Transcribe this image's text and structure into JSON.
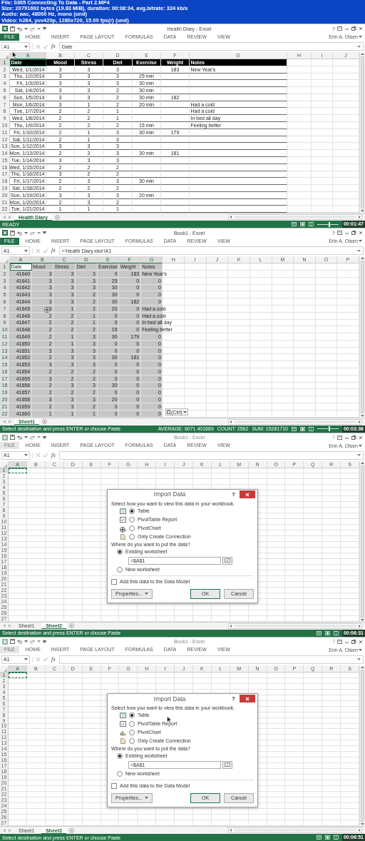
{
  "header": {
    "lines": [
      "File: 0305 Connecting To Data - Part 2.MP4",
      "Size: 20791692 bytes (19.83 MiB), duration: 00:08:34, avg.bitrate: 324 kb/s",
      "Audio: aac, 48000 Hz, mono (und)",
      "Video: h264, yuv420p, 1280x720, 15.00 fps(r) (und)"
    ]
  },
  "frames": [
    {
      "window_title": "Health Diary - Excel",
      "window_active": true,
      "help_button": "?",
      "ribbon_tabs": [
        {
          "label": "FILE",
          "kind": "file"
        },
        {
          "label": "HOME",
          "kind": "tab"
        },
        {
          "label": "INSERT",
          "kind": "tab"
        },
        {
          "label": "PAGE LAYOUT",
          "kind": "tab"
        },
        {
          "label": "FORMULAS",
          "kind": "tab"
        },
        {
          "label": "DATA",
          "kind": "tab"
        },
        {
          "label": "REVIEW",
          "kind": "tab"
        },
        {
          "label": "VIEW",
          "kind": "tab"
        }
      ],
      "user": "Erin A. Olsen",
      "name_box": "A1",
      "function_label": "fx",
      "formula": "Date",
      "columns": [
        "A",
        "B",
        "C",
        "D",
        "E",
        "F",
        "G",
        "H",
        "I",
        "J"
      ],
      "selection": {
        "kind": "cell"
      },
      "cursor": {
        "kind": "arrow"
      },
      "table": {
        "kind": "banded",
        "rows": [
          {
            "number": "1",
            "cells": [
              "Date",
              "Mood",
              "Stress",
              "Diet",
              "Exercise",
              "Weight",
              "Notes"
            ]
          },
          {
            "number": "2",
            "cells": [
              "Wed, 1/1/2014",
              "3",
              "3",
              "3",
              null,
              "183",
              "New Year's"
            ]
          },
          {
            "number": "3",
            "cells": [
              "Thu, 1/2/2014",
              "3",
              "3",
              "3",
              "25 min"
            ]
          },
          {
            "number": "4",
            "cells": [
              "Fri, 1/3/2014",
              "3",
              "3",
              "3",
              "30 min"
            ]
          },
          {
            "number": "5",
            "cells": [
              "Sat, 1/4/2014",
              "3",
              "3",
              "2",
              "30 min"
            ]
          },
          {
            "number": "6",
            "cells": [
              "Sun, 1/5/2014",
              "3",
              "3",
              "2",
              "30 min",
              "182"
            ]
          },
          {
            "number": "7",
            "cells": [
              "Mon, 1/6/2014",
              "3",
              "1",
              "2",
              "20 min",
              null,
              "Had a cold"
            ]
          },
          {
            "number": "8",
            "cells": [
              "Tue, 1/7/2014",
              "2",
              "2",
              "1",
              null,
              null,
              "Had a cold"
            ]
          },
          {
            "number": "9",
            "cells": [
              "Wed, 1/8/2014",
              "2",
              "2",
              "1",
              null,
              null,
              "In bed all day"
            ]
          },
          {
            "number": "10",
            "cells": [
              "Thu, 1/9/2014",
              "2",
              "2",
              "2",
              "15 min",
              null,
              "Feeling better"
            ]
          },
          {
            "number": "11",
            "cells": [
              "Fri, 1/10/2014",
              "2",
              "1",
              "3",
              "30 min",
              "179"
            ]
          },
          {
            "number": "12",
            "cells": [
              "Sat, 1/11/2014",
              "2",
              "1",
              "3"
            ]
          },
          {
            "number": "13",
            "cells": [
              "Sun, 1/12/2014",
              "3",
              "3",
              "3"
            ]
          },
          {
            "number": "14",
            "cells": [
              "Mon, 1/13/2014",
              "2",
              "3",
              "3",
              "30 min",
              "181"
            ]
          },
          {
            "number": "15",
            "cells": [
              "Tue, 1/14/2014",
              "3",
              "3",
              "3"
            ]
          },
          {
            "number": "16",
            "cells": [
              "Wed, 1/15/2014",
              "2",
              "2",
              "2"
            ]
          },
          {
            "number": "17",
            "cells": [
              "Thu, 1/16/2014",
              "3",
              "2",
              "2"
            ]
          },
          {
            "number": "18",
            "cells": [
              "Fri, 1/17/2014",
              "2",
              "3",
              "3",
              "30 min"
            ]
          },
          {
            "number": "19",
            "cells": [
              "Sat, 1/18/2014",
              "2",
              "2",
              "2"
            ]
          },
          {
            "number": "20",
            "cells": [
              "Sun, 1/19/2014",
              "3",
              "3",
              "3",
              "20 min"
            ]
          },
          {
            "number": "21",
            "cells": [
              "Mon, 1/20/2014",
              "2",
              "3",
              "2"
            ]
          },
          {
            "number": "22",
            "cells": [
              "Tue, 1/21/2014",
              "1",
              "1",
              "1"
            ]
          }
        ]
      },
      "sheet_tabs": [
        {
          "label": "Health Diary",
          "selected": true
        }
      ],
      "status": {
        "message": "READY"
      },
      "zoom_slider": {
        "level": 0.55
      },
      "timestamp": "00:01:47"
    },
    {
      "window_title": "Book1 - Excel",
      "window_active": true,
      "help_button": "?",
      "ribbon_tabs": [
        {
          "label": "FILE",
          "kind": "file"
        },
        {
          "label": "HOME",
          "kind": "tab"
        },
        {
          "label": "INSERT",
          "kind": "tab"
        },
        {
          "label": "PAGE LAYOUT",
          "kind": "tab"
        },
        {
          "label": "FORMULAS",
          "kind": "tab"
        },
        {
          "label": "DATA",
          "kind": "tab"
        },
        {
          "label": "REVIEW",
          "kind": "tab"
        },
        {
          "label": "VIEW",
          "kind": "tab"
        }
      ],
      "user": "Erin A. Olsen",
      "name_box": "A1",
      "function_label": "fx",
      "formula": "='Health Diary.xlsx'!A1",
      "columns": [
        "A",
        "B",
        "C",
        "D",
        "E",
        "F",
        "G",
        "H",
        "I",
        "J",
        "K",
        "L",
        "M",
        "N",
        "O",
        "P"
      ],
      "selection": {
        "kind": "range"
      },
      "cursor": {
        "kind": "move"
      },
      "table": {
        "kind": "plain",
        "rows": [
          {
            "number": "1",
            "cells": [
              "Date",
              "Mood",
              "Stress",
              "Diet",
              "Exercise",
              "Weight",
              "Notes"
            ]
          },
          {
            "number": "2",
            "cells": [
              "41640",
              "3",
              "3",
              "3",
              "0",
              "183",
              "New Year's"
            ]
          },
          {
            "number": "3",
            "cells": [
              "41641",
              "3",
              "3",
              "3",
              "25",
              "0",
              "0"
            ]
          },
          {
            "number": "4",
            "cells": [
              "41642",
              "3",
              "3",
              "3",
              "30",
              "0",
              "0"
            ]
          },
          {
            "number": "5",
            "cells": [
              "41643",
              "3",
              "3",
              "2",
              "30",
              "0",
              "0"
            ]
          },
          {
            "number": "6",
            "cells": [
              "41644",
              "3",
              "3",
              "2",
              "30",
              "182",
              "0"
            ]
          },
          {
            "number": "7",
            "cells": [
              "41645",
              "3",
              "1",
              "2",
              "20",
              "0",
              "Had a cold"
            ]
          },
          {
            "number": "8",
            "cells": [
              "41646",
              "2",
              "2",
              "1",
              "0",
              "0",
              "Had a cold"
            ]
          },
          {
            "number": "9",
            "cells": [
              "41647",
              "2",
              "2",
              "1",
              "0",
              "0",
              "In bed all day"
            ]
          },
          {
            "number": "10",
            "cells": [
              "41648",
              "2",
              "2",
              "2",
              "15",
              "0",
              "Feeling better"
            ]
          },
          {
            "number": "11",
            "cells": [
              "41649",
              "2",
              "1",
              "3",
              "30",
              "179",
              "0"
            ]
          },
          {
            "number": "12",
            "cells": [
              "41650",
              "2",
              "1",
              "3",
              "0",
              "0",
              "0"
            ]
          },
          {
            "number": "13",
            "cells": [
              "41651",
              "3",
              "3",
              "3",
              "0",
              "0",
              "0"
            ]
          },
          {
            "number": "14",
            "cells": [
              "41652",
              "2",
              "3",
              "3",
              "30",
              "181",
              "0"
            ]
          },
          {
            "number": "15",
            "cells": [
              "41653",
              "3",
              "3",
              "3",
              "0",
              "0",
              "0"
            ]
          },
          {
            "number": "16",
            "cells": [
              "41654",
              "2",
              "2",
              "2",
              "0",
              "0",
              "0"
            ]
          },
          {
            "number": "17",
            "cells": [
              "41655",
              "3",
              "2",
              "2",
              "0",
              "0",
              "0"
            ]
          },
          {
            "number": "18",
            "cells": [
              "41656",
              "2",
              "3",
              "3",
              "30",
              "0",
              "0"
            ]
          },
          {
            "number": "19",
            "cells": [
              "41657",
              "2",
              "2",
              "2",
              "0",
              "0",
              "0"
            ]
          },
          {
            "number": "20",
            "cells": [
              "41658",
              "3",
              "3",
              "3",
              "20",
              "0",
              "0"
            ]
          },
          {
            "number": "21",
            "cells": [
              "41659",
              "2",
              "3",
              "2",
              "0",
              "0",
              "0"
            ]
          },
          {
            "number": "22",
            "cells": [
              "41660",
              "1",
              "1",
              "1",
              "0",
              "0",
              "0"
            ]
          }
        ]
      },
      "paste_options": {
        "label": "(Ctrl)"
      },
      "sheet_tabs": [
        {
          "label": "Sheet1",
          "selected": true
        }
      ],
      "status": {
        "message": "Select destination and press ENTER or choose Paste",
        "stats": [
          "AVERAGE: 6071.401669",
          "COUNT: 2562",
          "SUM: 15281710"
        ]
      },
      "zoom_slider": {
        "level": 0.55
      },
      "timestamp": "00:03:36"
    },
    {
      "window_title": "Book1 - Excel",
      "window_active": false,
      "help_button": "?",
      "ribbon_tabs": [
        {
          "label": "FILE",
          "kind": "file"
        },
        {
          "label": "HOME",
          "kind": "tab"
        },
        {
          "label": "INSERT",
          "kind": "tab"
        },
        {
          "label": "PAGE LAYOUT",
          "kind": "tab"
        },
        {
          "label": "FORMULAS",
          "kind": "tab"
        },
        {
          "label": "DATA",
          "kind": "tab"
        },
        {
          "label": "REVIEW",
          "kind": "tab"
        },
        {
          "label": "VIEW",
          "kind": "tab"
        }
      ],
      "user": "Erin A. Olsen",
      "name_box": "A1",
      "function_label": "fx",
      "columns": [
        "A",
        "B",
        "C",
        "D",
        "E",
        "F",
        "G",
        "H",
        "I",
        "J",
        "K",
        "L",
        "M",
        "N",
        "O",
        "P",
        "Q",
        "R",
        "S"
      ],
      "selection": {
        "kind": "marquee"
      },
      "cursor": {
        "kind": "move"
      },
      "table": {
        "kind": "plain",
        "rows": [
          {
            "number": "1"
          },
          {
            "number": "2"
          },
          {
            "number": "3"
          },
          {
            "number": "4"
          },
          {
            "number": "5"
          },
          {
            "number": "6"
          },
          {
            "number": "7"
          },
          {
            "number": "8"
          },
          {
            "number": "9"
          },
          {
            "number": "10"
          },
          {
            "number": "11"
          },
          {
            "number": "12"
          },
          {
            "number": "13"
          },
          {
            "number": "14"
          },
          {
            "number": "15"
          },
          {
            "number": "16"
          },
          {
            "number": "17"
          },
          {
            "number": "18"
          },
          {
            "number": "19"
          },
          {
            "number": "20"
          },
          {
            "number": "21"
          },
          {
            "number": "22"
          },
          {
            "number": "23"
          },
          {
            "number": "24"
          },
          {
            "number": "25"
          },
          {
            "number": "26"
          },
          {
            "number": "27"
          }
        ]
      },
      "dialog": {
        "title": "Import Data",
        "help": "?",
        "prompt": "Select how you want to view this data in your workbook.",
        "view_options": [
          {
            "label": "Table",
            "kind": "table",
            "selected": true
          },
          {
            "label": "PivotTable Report",
            "kind": "pivottable",
            "selected": false
          },
          {
            "label": "PivotChart",
            "kind": "pivotchart",
            "selected": false
          },
          {
            "label": "Only Create Connection",
            "kind": "connection",
            "selected": false
          }
        ],
        "location_prompt": "Where do you want to put the data?",
        "location_options": [
          {
            "label": "Existing worksheet",
            "selected": true
          },
          {
            "label": "New worksheet",
            "selected": false
          }
        ],
        "range": "=$A$1",
        "data_model": {
          "label": "Add this data to the Data Model",
          "checked": false
        },
        "buttons": [
          {
            "label": "Properties...",
            "kind": "menu"
          },
          {
            "label": "OK",
            "kind": "default"
          },
          {
            "label": "Cancel",
            "kind": "plain"
          }
        ]
      },
      "sheet_tabs": [
        {
          "label": "Sheet1",
          "selected": false
        },
        {
          "label": "Sheet2",
          "selected": true
        }
      ],
      "status": {
        "message": "Select destination and press ENTER or choose Paste"
      },
      "timestamp": "00:06:31"
    },
    {
      "window_title": "Book1 - Excel",
      "window_active": false,
      "help_button": "?",
      "ribbon_tabs": [
        {
          "label": "FILE",
          "kind": "file"
        },
        {
          "label": "HOME",
          "kind": "tab"
        },
        {
          "label": "INSERT",
          "kind": "tab"
        },
        {
          "label": "PAGE LAYOUT",
          "kind": "tab"
        },
        {
          "label": "FORMULAS",
          "kind": "tab"
        },
        {
          "label": "DATA",
          "kind": "tab"
        },
        {
          "label": "REVIEW",
          "kind": "tab"
        },
        {
          "label": "VIEW",
          "kind": "tab"
        }
      ],
      "user": "Erin A. Olsen",
      "name_box": "A1",
      "function_label": "fx",
      "columns": [
        "A",
        "B",
        "C",
        "D",
        "E",
        "F",
        "G",
        "H",
        "I",
        "J",
        "K",
        "L",
        "M",
        "N",
        "O",
        "P",
        "Q",
        "R",
        "S"
      ],
      "selection": {
        "kind": "marquee"
      },
      "cursor": {
        "kind": "arrow"
      },
      "table": {
        "kind": "plain",
        "rows": [
          {
            "number": "1"
          },
          {
            "number": "2"
          },
          {
            "number": "3"
          },
          {
            "number": "4"
          },
          {
            "number": "5"
          },
          {
            "number": "6"
          },
          {
            "number": "7"
          },
          {
            "number": "8"
          },
          {
            "number": "9"
          },
          {
            "number": "10"
          },
          {
            "number": "11"
          },
          {
            "number": "12"
          },
          {
            "number": "13"
          },
          {
            "number": "14"
          },
          {
            "number": "15"
          },
          {
            "number": "16"
          },
          {
            "number": "17"
          },
          {
            "number": "18"
          },
          {
            "number": "19"
          },
          {
            "number": "20"
          },
          {
            "number": "21"
          },
          {
            "number": "22"
          },
          {
            "number": "23"
          },
          {
            "number": "24"
          },
          {
            "number": "25"
          },
          {
            "number": "26"
          },
          {
            "number": "27"
          }
        ]
      },
      "dialog": {
        "title": "Import Data",
        "help": "?",
        "prompt": "Select how you want to view this data in your workbook.",
        "view_options": [
          {
            "label": "Table",
            "kind": "table",
            "selected": true
          },
          {
            "label": "PivotTable Report",
            "kind": "pivottable",
            "selected": false
          },
          {
            "label": "PivotChart",
            "kind": "pivotchart",
            "selected": false
          },
          {
            "label": "Only Create Connection",
            "kind": "connection",
            "selected": false
          }
        ],
        "location_prompt": "Where do you want to put the data?",
        "location_options": [
          {
            "label": "Existing worksheet",
            "selected": true
          },
          {
            "label": "New worksheet",
            "selected": false
          }
        ],
        "range": "=$A$1",
        "data_model": {
          "label": "Add this data to the Data Model",
          "checked": false
        },
        "buttons": [
          {
            "label": "Properties...",
            "kind": "menu"
          },
          {
            "label": "OK",
            "kind": "default"
          },
          {
            "label": "Cancel",
            "kind": "plain"
          }
        ]
      },
      "sheet_tabs": [
        {
          "label": "Sheet1",
          "selected": false
        },
        {
          "label": "Sheet2",
          "selected": true
        }
      ],
      "status": {
        "message": "Select destination and press ENTER or choose Paste"
      },
      "timestamp": "00:06:51"
    }
  ]
}
